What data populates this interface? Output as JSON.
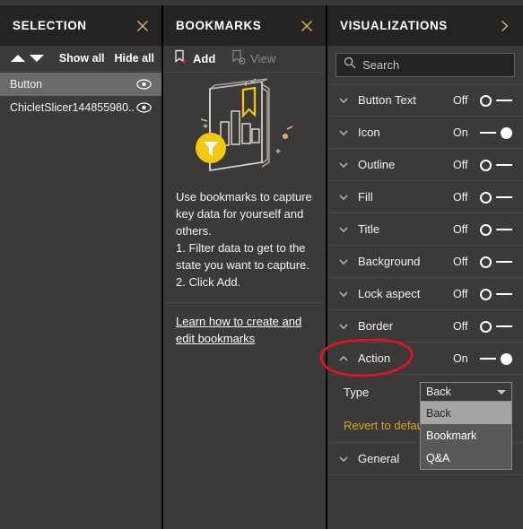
{
  "colors": {
    "pane_bg": "#3b3a39",
    "header_bg": "#252423",
    "accent_gold": "#d9b36c",
    "revert_link": "#d9a820",
    "selected_row": "#6b6a68",
    "annotation_red": "#e81123",
    "text_primary": "#f3f2f1",
    "divider": "#484644"
  },
  "selection": {
    "title": "SELECTION",
    "close_icon": "close-icon",
    "toolbar": {
      "move_up_icon": "arrow-up-icon",
      "move_down_icon": "arrow-down-icon",
      "show_all_label": "Show all",
      "hide_all_label": "Hide all"
    },
    "items": [
      {
        "label": "Button",
        "selected": true,
        "visibility_icon": "eye-icon"
      },
      {
        "label": "ChicletSlicer144855980...",
        "selected": false,
        "visibility_icon": "eye-icon"
      }
    ]
  },
  "bookmarks": {
    "title": "BOOKMARKS",
    "close_icon": "close-icon",
    "toolbar": [
      {
        "label": "Add",
        "icon": "bookmark-add-icon",
        "enabled": true
      },
      {
        "label": "View",
        "icon": "bookmark-view-icon",
        "enabled": false
      }
    ],
    "illustration": "bookmarks-empty-state-illustration",
    "empty_text": "Use bookmarks to capture key data for yourself and others.\n1. Filter data to get to the state you want to capture.\n2. Click Add.",
    "learn_link": "Learn how to create and edit bookmarks"
  },
  "visualizations": {
    "title": "VISUALIZATIONS",
    "expand_icon": "chevron-right-icon",
    "search": {
      "placeholder": "Search",
      "value": "",
      "icon": "search-icon"
    },
    "properties": [
      {
        "label": "Button Text",
        "state": "Off",
        "on": false,
        "expanded": false
      },
      {
        "label": "Icon",
        "state": "On",
        "on": true,
        "expanded": false
      },
      {
        "label": "Outline",
        "state": "Off",
        "on": false,
        "expanded": false
      },
      {
        "label": "Fill",
        "state": "Off",
        "on": false,
        "expanded": false
      },
      {
        "label": "Title",
        "state": "Off",
        "on": false,
        "expanded": false
      },
      {
        "label": "Background",
        "state": "Off",
        "on": false,
        "expanded": false
      },
      {
        "label": "Lock aspect",
        "state": "Off",
        "on": false,
        "expanded": false
      },
      {
        "label": "Border",
        "state": "Off",
        "on": false,
        "expanded": false
      },
      {
        "label": "Action",
        "state": "On",
        "on": true,
        "expanded": true
      }
    ],
    "action_section": {
      "type_label": "Type",
      "revert_label": "Revert to default",
      "dropdown": {
        "selected": "Back",
        "open": true,
        "options": [
          {
            "label": "Back",
            "highlighted": true
          },
          {
            "label": "Bookmark",
            "highlighted": false
          },
          {
            "label": "Q&A",
            "highlighted": false
          }
        ]
      }
    },
    "general_section": {
      "label": "General",
      "expanded": false
    }
  },
  "annotation": {
    "shape": "red-ellipse",
    "target": "Action"
  }
}
